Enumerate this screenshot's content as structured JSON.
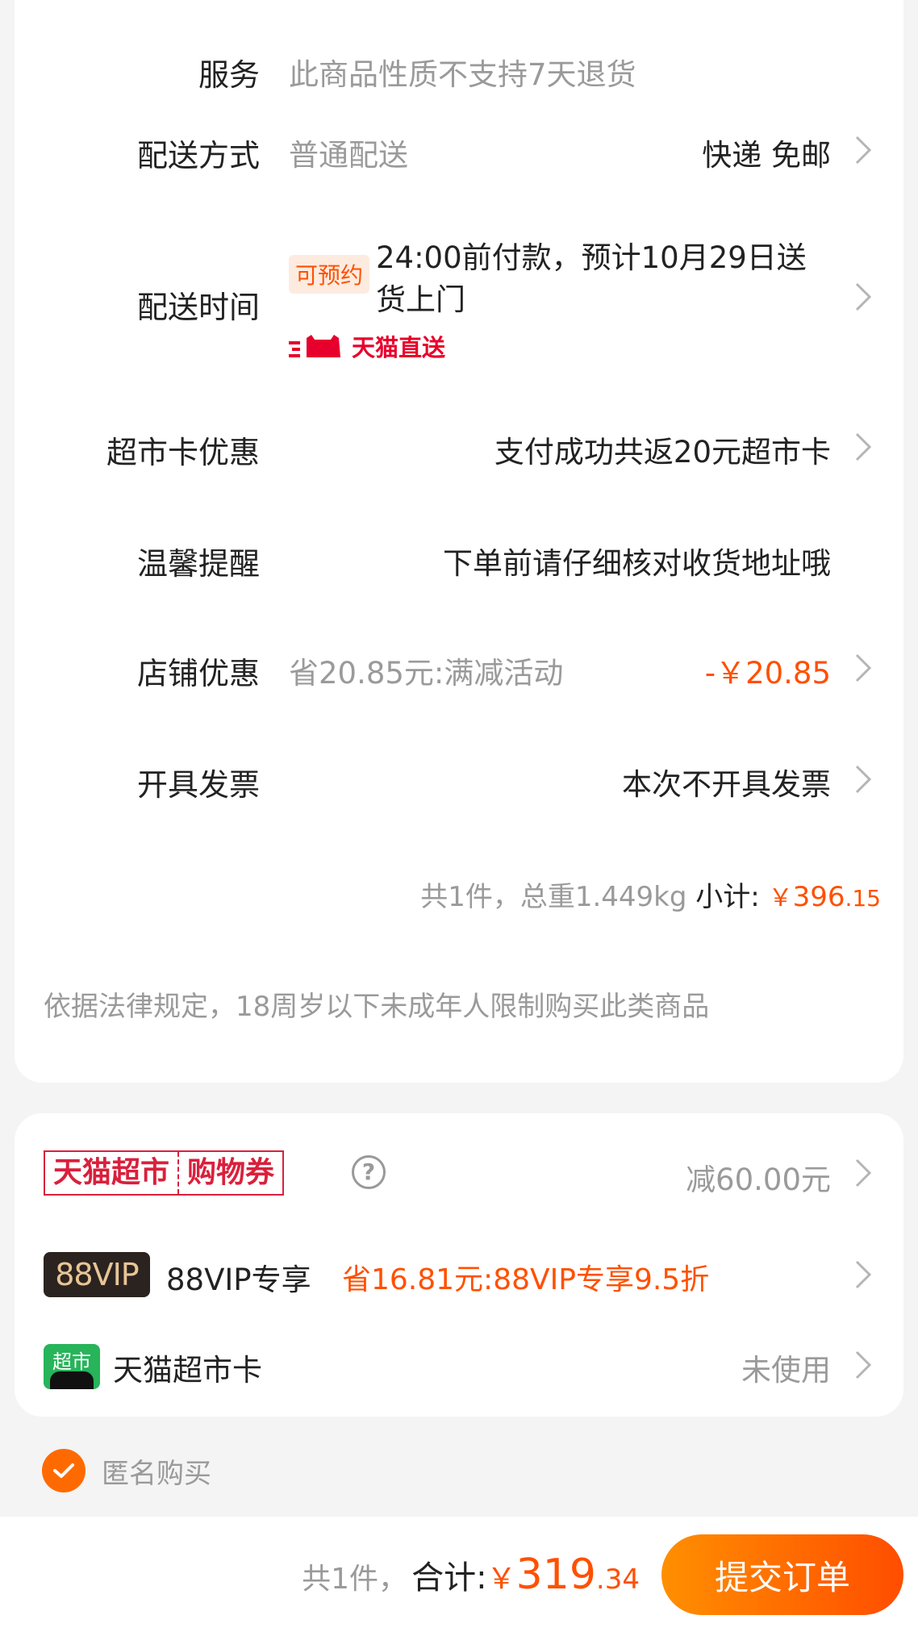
{
  "order": {
    "service": {
      "label": "服务",
      "value": "此商品性质不支持7天退货"
    },
    "delivery_method": {
      "label": "配送方式",
      "value": "普通配送",
      "right": "快递 免邮"
    },
    "delivery_time": {
      "label": "配送时间",
      "tag": "可预约",
      "text": "24:00前付款，预计10月29日送货上门",
      "badge": "天猫直送"
    },
    "market_card_promo": {
      "label": "超市卡优惠",
      "right": "支付成功共返20元超市卡"
    },
    "reminder": {
      "label": "温馨提醒",
      "right": "下单前请仔细核对收货地址哦"
    },
    "store_discount": {
      "label": "店铺优惠",
      "value": "省20.85元:满减活动",
      "right": "-￥20.85"
    },
    "invoice": {
      "label": "开具发票",
      "right": "本次不开具发票"
    },
    "subtotal": {
      "summary": "共1件，总重1.449kg",
      "label": "小计:",
      "currency": "￥",
      "main": "396",
      "cents": ".15"
    },
    "legal_notice": "依据法律规定，18周岁以下未成年人限制购买此类商品"
  },
  "coupons": {
    "tmall_coupon": {
      "badge_left": "天猫超市",
      "badge_right": "购物券",
      "help": "?",
      "right": "减60.00元"
    },
    "vip": {
      "badge": "88VIP",
      "label": "88VIP专享",
      "promo": "省16.81元:88VIP专享9.5折"
    },
    "market_card": {
      "icon_text": "超市",
      "label": "天猫超市卡",
      "right": "未使用"
    }
  },
  "anonymous": {
    "label": "匿名购买",
    "checked": true
  },
  "footer": {
    "count": "共1件，",
    "total_label": "合计:",
    "currency": "￥",
    "total_main": "319",
    "total_cents": ".34",
    "submit": "提交订单"
  },
  "colors": {
    "accent": "#ff5000",
    "tmall_red": "#e8002d",
    "vip_gold": "#e8c595"
  }
}
